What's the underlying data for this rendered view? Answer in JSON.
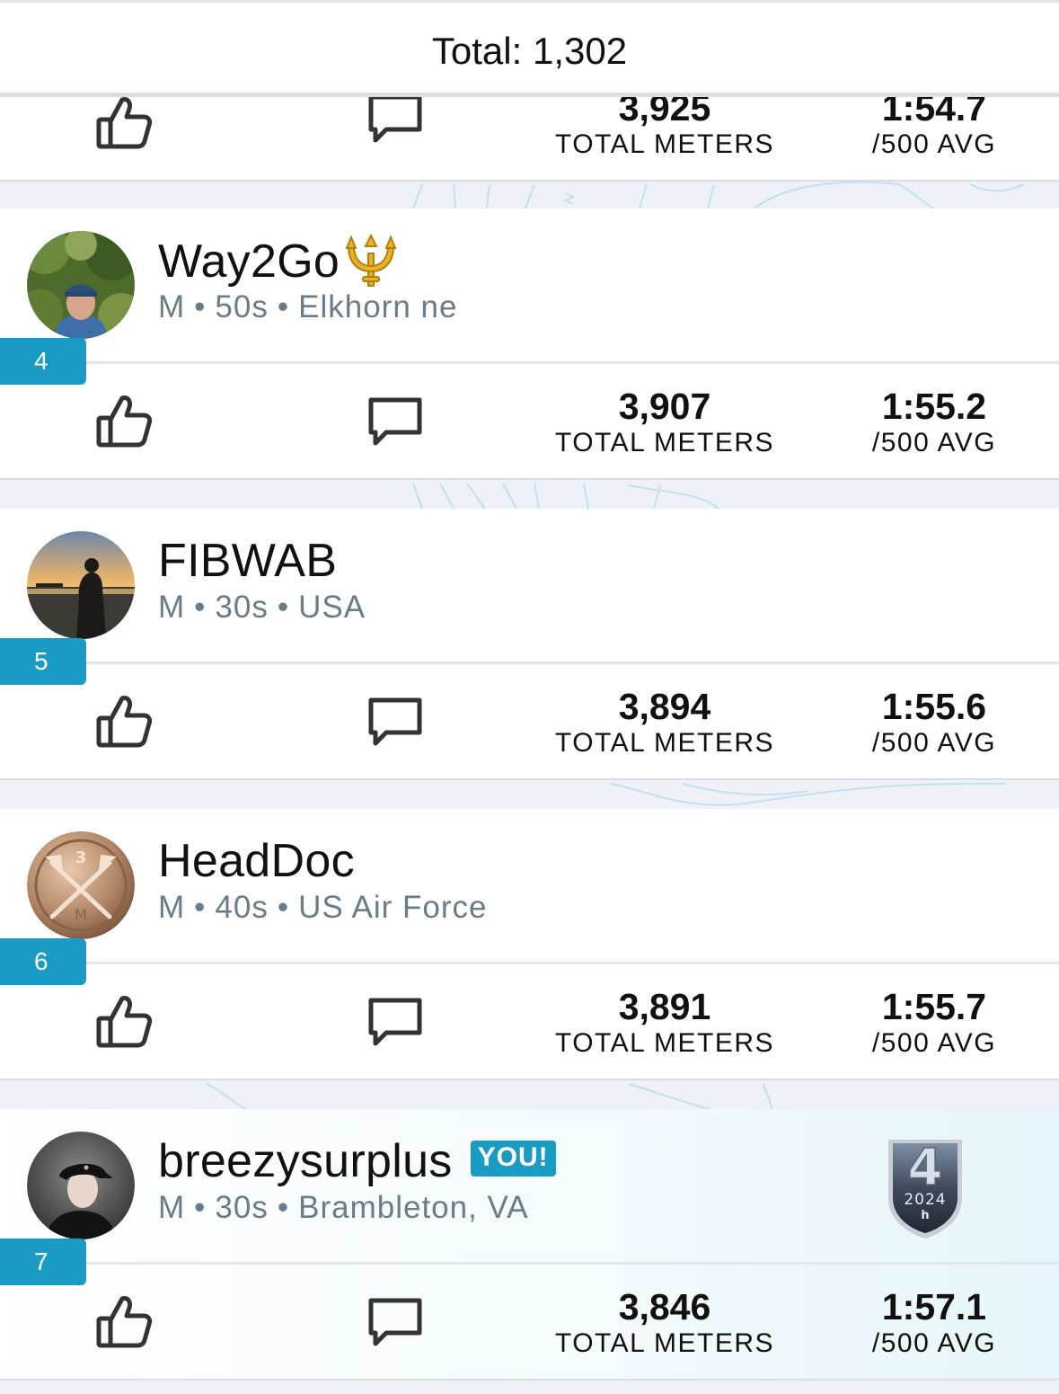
{
  "header": {
    "total": "Total: 1,302"
  },
  "labels": {
    "total_meters": "TOTAL METERS",
    "avg": "/500 AVG",
    "you": "YOU!"
  },
  "partial_row": {
    "meters": "3,925",
    "pace": "1:54.7"
  },
  "entries": [
    {
      "rank": "4",
      "username": "Way2Go",
      "emoji": "trident-icon",
      "gender": "M",
      "age": "50s",
      "location": "Elkhorn ne",
      "meters": "3,907",
      "pace": "1:55.2",
      "avatar": "outdoor-forest-photo"
    },
    {
      "rank": "5",
      "username": "FIBWAB",
      "gender": "M",
      "age": "30s",
      "location": "USA",
      "meters": "3,894",
      "pace": "1:55.6",
      "avatar": "sunset-lake-photo"
    },
    {
      "rank": "6",
      "username": "HeadDoc",
      "gender": "M",
      "age": "40s",
      "location": "US Air Force",
      "meters": "3,891",
      "pace": "1:55.7",
      "avatar": "bronze-oars-medal"
    },
    {
      "rank": "7",
      "username": "breezysurplus",
      "gender": "M",
      "age": "30s",
      "location": "Brambleton, VA",
      "meters": "3,846",
      "pace": "1:57.1",
      "avatar": "person-cap-photo",
      "is_you": true,
      "badge": {
        "number": "4",
        "year": "2024",
        "letter": "h"
      }
    }
  ],
  "colors": {
    "accent": "#1a9bc4",
    "meta_text": "#6a7c8a",
    "background": "#eef1f8"
  }
}
